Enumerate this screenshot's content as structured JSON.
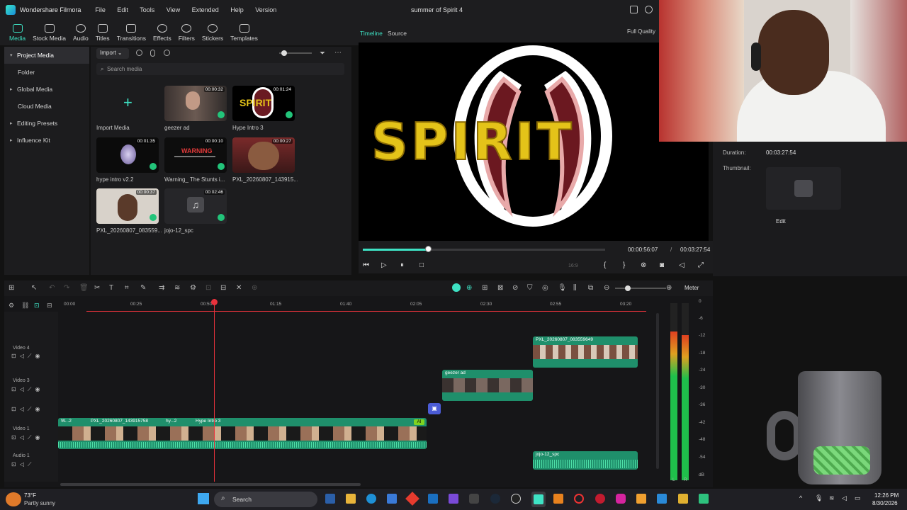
{
  "window": {
    "app_name": "Wondershare Filmora",
    "menu": [
      "File",
      "Edit",
      "Tools",
      "View",
      "Extended",
      "Help",
      "Version"
    ],
    "doc_title": "summer of Spirit 4"
  },
  "toolbar": {
    "items": [
      {
        "label": "Media",
        "icon": "media-icon",
        "active": true
      },
      {
        "label": "Stock Media",
        "icon": "stock-media-icon"
      },
      {
        "label": "Audio",
        "icon": "audio-icon"
      },
      {
        "label": "Titles",
        "icon": "titles-icon"
      },
      {
        "label": "Transitions",
        "icon": "transitions-icon"
      },
      {
        "label": "Effects",
        "icon": "effects-icon"
      },
      {
        "label": "Filters",
        "icon": "filters-icon"
      },
      {
        "label": "Stickers",
        "icon": "stickers-icon"
      },
      {
        "label": "Templates",
        "icon": "templates-icon"
      }
    ]
  },
  "sidenav": {
    "items": [
      {
        "label": "Project Media",
        "caret": true,
        "selected": true
      },
      {
        "label": "Folder",
        "caret": false
      },
      {
        "label": "Global Media",
        "caret": true
      },
      {
        "label": "Cloud Media",
        "caret": false
      },
      {
        "label": "Editing Presets",
        "caret": true
      },
      {
        "label": "Influence Kit",
        "caret": true
      }
    ]
  },
  "media": {
    "import_label": "Import",
    "search_placeholder": "Search media",
    "import_tile_label": "Import Media",
    "items": [
      {
        "name": "geezer ad",
        "duration": "00:00:32"
      },
      {
        "name": "Hype Intro 3",
        "duration": "00:01:24"
      },
      {
        "name": "hype intro v2.2",
        "duration": "00:01:35"
      },
      {
        "name": "Warning_ The Stunts i...",
        "duration": "00:00:10",
        "thumb_text": "WARNING"
      },
      {
        "name": "PXL_20260807_143915...",
        "duration": "00:00:27"
      },
      {
        "name": "PXL_20260807_083559...",
        "duration": "00:00:37"
      },
      {
        "name": "jojo-12_spc",
        "duration": "00:02:46"
      }
    ]
  },
  "preview": {
    "tab_timeline": "Timeline",
    "tab_source": "Source",
    "quality": "Full Quality",
    "overlay_text": "SPIRIT",
    "current_time": "00:00:56:07",
    "separator": "/",
    "total_time": "00:03:27:54",
    "aspect": "16:9",
    "progress": 0.27
  },
  "properties": {
    "duration_label": "Duration:",
    "duration_value": "00:03:27:54",
    "thumbnail_label": "Thumbnail:",
    "edit_label": "Edit"
  },
  "timeline": {
    "meter_label": "Meter",
    "ruler": [
      "00:00",
      "00:25",
      "00:50",
      "01:15",
      "01:40",
      "02:05",
      "02:30",
      "02:55",
      "03:20"
    ],
    "tracks": [
      {
        "label": "Video 4"
      },
      {
        "label": "Video 3"
      },
      {
        "label": ""
      },
      {
        "label": "Video 1"
      },
      {
        "label": "Audio 1"
      }
    ],
    "clips": {
      "v4": "PXL_20260807_083559649",
      "v3": "geezer ad",
      "v1a": "W...2",
      "v1b": "PXL_20260807_143915758",
      "v1c": "hy...2",
      "v1d": "Hype Intro 3",
      "ai_badge": "AI",
      "a1": "jojo-12_spc"
    },
    "meter_scale": [
      "0",
      "-6",
      "-12",
      "-18",
      "-24",
      "-30",
      "-36",
      "-42",
      "-48",
      "-54",
      "dB"
    ],
    "meter_lr": [
      "L",
      "R"
    ]
  },
  "taskbar": {
    "temp": "73°F",
    "weather": "Partly sunny",
    "search": "Search",
    "time": "12:26 PM",
    "date": "8/30/2026"
  },
  "colors": {
    "accent": "#3ee2c4",
    "playhead": "#e8323c",
    "clip_green": "#1f8f6b",
    "spirit_gold": "#e4c319"
  }
}
